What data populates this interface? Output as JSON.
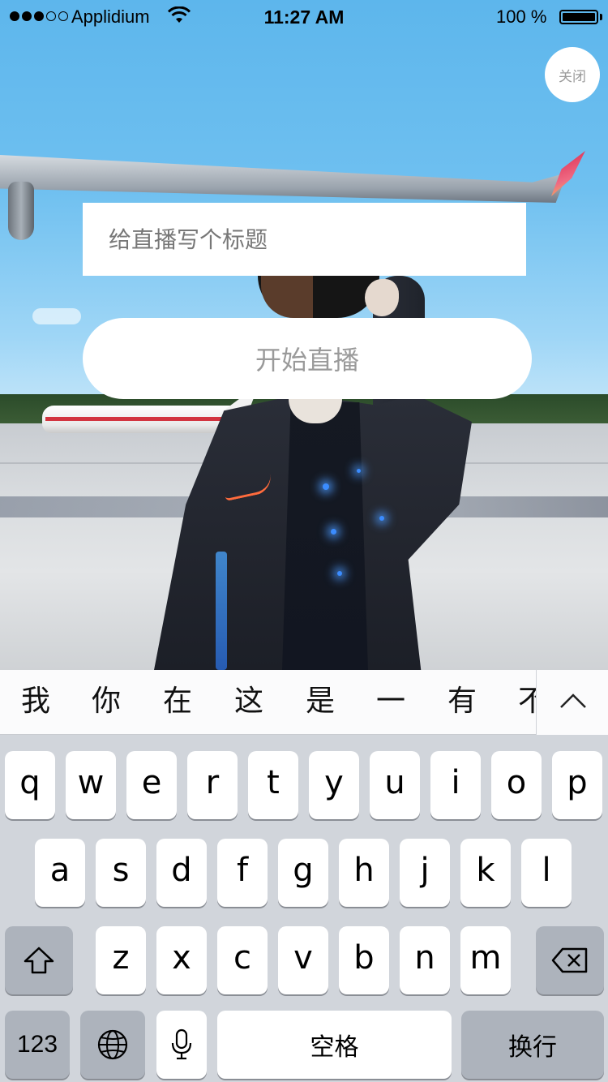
{
  "status_bar": {
    "carrier": "Applidium",
    "time": "11:27 AM",
    "battery": "100 %",
    "icons": [
      "signal-dots-icon",
      "wifi-icon",
      "battery-icon"
    ]
  },
  "close_button": {
    "label": "关闭"
  },
  "title_input": {
    "placeholder": "给直播写个标题",
    "value": ""
  },
  "start_button": {
    "label": "开始直播"
  },
  "candidate_bar": {
    "candidates": [
      "我",
      "你",
      "在",
      "这",
      "是",
      "一",
      "有",
      "不"
    ],
    "expand_icon": "chevron-up-icon"
  },
  "keyboard": {
    "row1": [
      "q",
      "w",
      "e",
      "r",
      "t",
      "y",
      "u",
      "i",
      "o",
      "p"
    ],
    "row2": [
      "a",
      "s",
      "d",
      "f",
      "g",
      "h",
      "j",
      "k",
      "l"
    ],
    "row3": [
      "z",
      "x",
      "c",
      "v",
      "b",
      "n",
      "m"
    ],
    "shift_icon": "shift-icon",
    "delete_icon": "backspace-icon",
    "numbers_label": "123",
    "globe_icon": "globe-icon",
    "mic_icon": "microphone-icon",
    "space_label": "空格",
    "return_label": "换行"
  }
}
